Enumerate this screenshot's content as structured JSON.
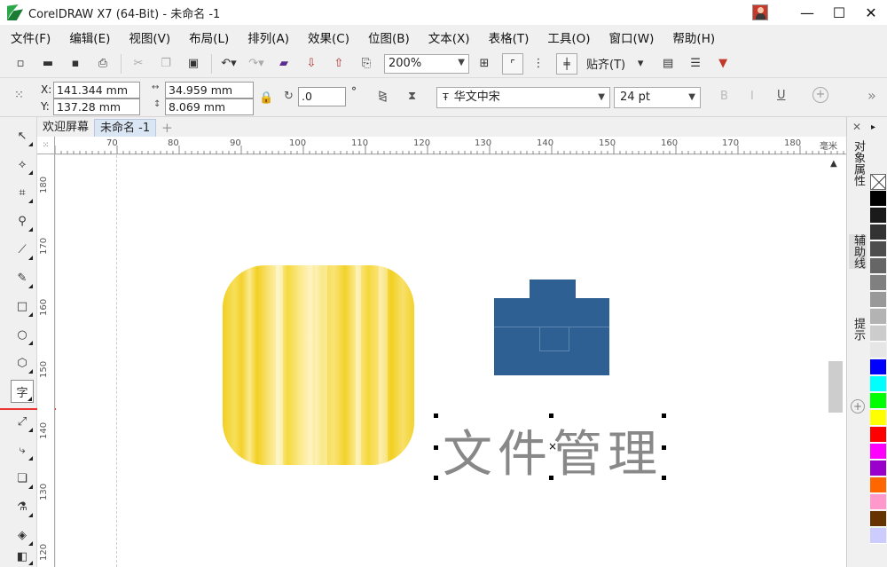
{
  "window": {
    "title": "CorelDRAW X7 (64-Bit) - 未命名 -1",
    "minimize": "—",
    "maximize": "☐",
    "close": "✕"
  },
  "menu": [
    "文件(F)",
    "编辑(E)",
    "视图(V)",
    "布局(L)",
    "排列(A)",
    "效果(C)",
    "位图(B)",
    "文本(X)",
    "表格(T)",
    "工具(O)",
    "窗口(W)",
    "帮助(H)"
  ],
  "toolbar": {
    "zoom": "200%",
    "snap_label": "贴齐(T)"
  },
  "propbar": {
    "x_label": "X:",
    "x_value": "141.344 mm",
    "y_label": "Y:",
    "y_value": "137.28 mm",
    "w_value": "34.959 mm",
    "h_value": "8.069 mm",
    "rotation": ".0",
    "degree": "°",
    "font_name": "华文中宋",
    "font_size": "24 pt",
    "underline": "U",
    "more": "»"
  },
  "tabs": {
    "welcome": "欢迎屏幕",
    "document": "未命名 -1",
    "add": "+"
  },
  "ruler": {
    "corner": "毫米",
    "h_ticks": [
      "70",
      "80",
      "90",
      "100",
      "110",
      "120",
      "130",
      "140",
      "150",
      "160",
      "170",
      "180"
    ],
    "v_ticks": [
      "180",
      "170",
      "160",
      "150",
      "140",
      "130",
      "120"
    ]
  },
  "canvas": {
    "text": "文件管理"
  },
  "docker": {
    "tab1": "对象属性",
    "tab2": "辅助线",
    "tab3": "提示"
  },
  "palette": [
    "#000000",
    "#1a1a1a",
    "#333333",
    "#4d4d4d",
    "#666666",
    "#808080",
    "#999999",
    "#b3b3b3",
    "#cccccc",
    "#e6e6e6",
    "#0000ff",
    "#00ffff",
    "#00ff00",
    "#ffff00",
    "#ff0000",
    "#ff00ff",
    "#9900cc",
    "#ff6600",
    "#ff99cc",
    "#663300",
    "#ccccff"
  ]
}
